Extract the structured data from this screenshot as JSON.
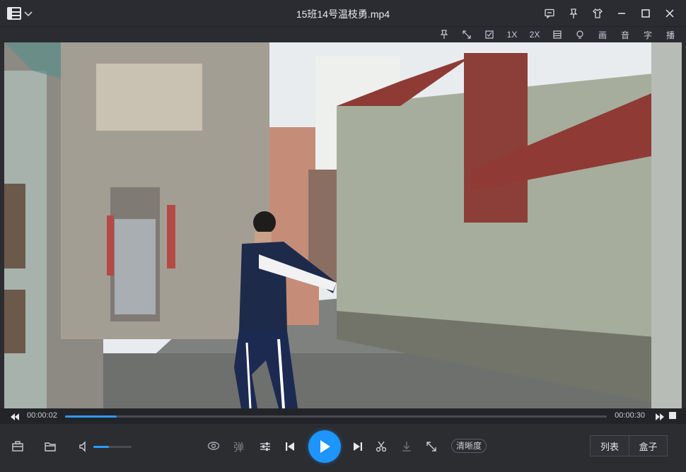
{
  "window": {
    "title": "15班14号温枝勇.mp4"
  },
  "titlebar_icons": [
    "feedback-icon",
    "pin-icon",
    "skin-icon",
    "minimize-icon",
    "maximize-icon",
    "close-icon"
  ],
  "toolbar": {
    "items": [
      {
        "name": "pin-top",
        "label": ""
      },
      {
        "name": "fullscreen",
        "label": ""
      },
      {
        "name": "screenshot",
        "label": ""
      },
      {
        "name": "size-1x",
        "label": "1X"
      },
      {
        "name": "size-2x",
        "label": "2X"
      },
      {
        "name": "list-view",
        "label": ""
      },
      {
        "name": "light",
        "label": ""
      },
      {
        "name": "picture",
        "label": "画"
      },
      {
        "name": "audio",
        "label": "音"
      },
      {
        "name": "subtitle",
        "label": "字"
      },
      {
        "name": "playback",
        "label": "播"
      }
    ]
  },
  "playback": {
    "current_time": "00:00:02",
    "duration": "00:00:30",
    "progress_percent": 9.5,
    "volume_percent": 40
  },
  "controls": {
    "danmu_label": "弹",
    "quality_label": "清晰度",
    "playlist_label": "列表",
    "box_label": "盒子"
  },
  "colors": {
    "accent": "#1e94ff",
    "background": "#2b2d31"
  }
}
